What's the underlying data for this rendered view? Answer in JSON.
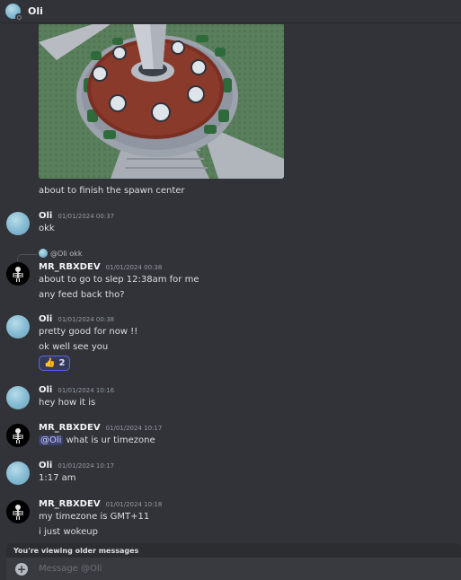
{
  "header": {
    "title": "Oli",
    "avatar_icon": "moon-avatar-icon"
  },
  "attachment": {
    "caption": "about to finish the spawn center"
  },
  "messages": [
    {
      "author": "Oli",
      "timestamp": "01/01/2024 00:37",
      "lines": [
        "okk"
      ]
    },
    {
      "reply_to": "@Oli okk",
      "author": "MR_RBXDEV",
      "timestamp": "01/01/2024 00:38",
      "lines": [
        "about to go to slep 12:38am for me",
        "any feed back tho?"
      ]
    },
    {
      "author": "Oli",
      "timestamp": "01/01/2024 00:38",
      "lines": [
        "pretty good for now !!",
        "ok well see you"
      ],
      "reaction": {
        "emoji": "👍",
        "count": "2"
      }
    },
    {
      "author": "Oli",
      "timestamp": "01/01/2024 10:16",
      "lines": [
        "hey how it is"
      ]
    },
    {
      "author": "MR_RBXDEV",
      "timestamp": "01/01/2024 10:17",
      "mention": "@Oli",
      "lines": [
        "what is ur timezone"
      ]
    },
    {
      "author": "Oli",
      "timestamp": "01/01/2024 10:17",
      "lines": [
        "1:17 am"
      ]
    },
    {
      "author": "MR_RBXDEV",
      "timestamp": "01/01/2024 10:18",
      "lines": [
        "my timezone is GMT+11",
        "i just wokeup"
      ]
    }
  ],
  "older_banner": "You're viewing older messages",
  "composer": {
    "placeholder": "Message @Oli"
  },
  "colors": {
    "background": "#313338",
    "mention": "#5865f2",
    "composer": "#383a40"
  }
}
